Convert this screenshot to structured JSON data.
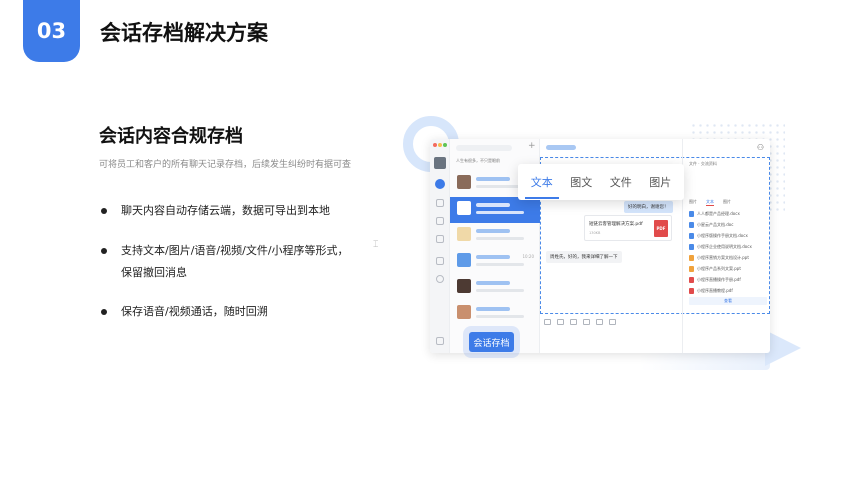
{
  "header": {
    "number": "03",
    "title": "会话存档解决方案"
  },
  "section": {
    "title": "会话内容合规存档",
    "description": "可将员工和客户的所有聊天记录存档，后续发生纠纷时有据可查"
  },
  "bullets": [
    {
      "line1": "聊天内容自动存储云端，数据可导出到本地",
      "line2": ""
    },
    {
      "line1": "支持文本/图片/语音/视频/文件/小程序等形式，",
      "line2": "保留撤回消息"
    },
    {
      "line1": "保存语音/视频通话，随时回溯",
      "line2": ""
    }
  ],
  "app": {
    "list_header": "人生有很多，不只是眼前",
    "chat_items": [
      {
        "time": ""
      },
      {
        "time": ""
      },
      {
        "time": ""
      },
      {
        "time": "10:20"
      },
      {
        "time": ""
      },
      {
        "time": ""
      }
    ],
    "messages": {
      "msg1": "好的明白，谢谢您！",
      "file_name": "短链云客管理解决方案.pdf",
      "file_size": "130KB",
      "file_badge": "PDF",
      "msg2": "周姓氏，好的，我来详细了解一下"
    },
    "info": {
      "label": "文件 · 交流资料",
      "tabs": [
        "图片",
        "文本",
        "图片"
      ],
      "files": [
        "人人都是产品经理.docx",
        "小星云产品文档.doc",
        "小程序版操作手册文档.docx",
        "小程序企业使用说明文档.docx",
        "小程序营销方案文档设计.ppt",
        "小程序产品系列文案.ppt",
        "小程序直播操作手册.pdf",
        "小程序直播教程.pdf"
      ],
      "button": "查看"
    }
  },
  "float_tabs": [
    "文本",
    "图文",
    "文件",
    "图片"
  ],
  "archive_button": "会话存档",
  "colors": {
    "accent": "#3d7be8",
    "pdf": "#e14b4b"
  }
}
